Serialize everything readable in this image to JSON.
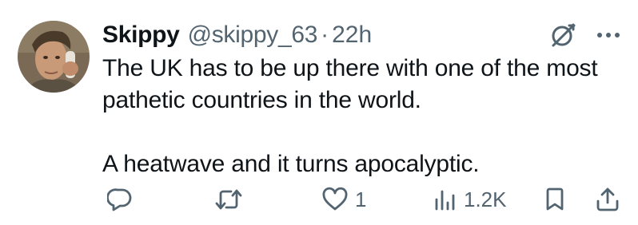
{
  "tweet": {
    "author": {
      "name": "Skippy",
      "handle": "@skippy_63",
      "separator": "·",
      "time": "22h",
      "avatar": "avatar-photo"
    },
    "text_lines": [
      "The UK has to be up there with one of the most",
      "pathetic countries in the world.",
      "A heatwave and it turns apocalyptic."
    ],
    "actions": {
      "reply": {
        "icon": "reply-icon",
        "count": ""
      },
      "retweet": {
        "icon": "retweet-icon",
        "count": ""
      },
      "like": {
        "icon": "heart-icon",
        "count": "1"
      },
      "views": {
        "icon": "views-icon",
        "count": "1.2K"
      },
      "bookmark": {
        "icon": "bookmark-icon"
      },
      "share": {
        "icon": "share-icon"
      }
    },
    "header_icons": [
      "grok-icon",
      "more-icon"
    ]
  },
  "colors": {
    "text": "#0f1419",
    "secondary": "#536471",
    "background": "#ffffff"
  }
}
